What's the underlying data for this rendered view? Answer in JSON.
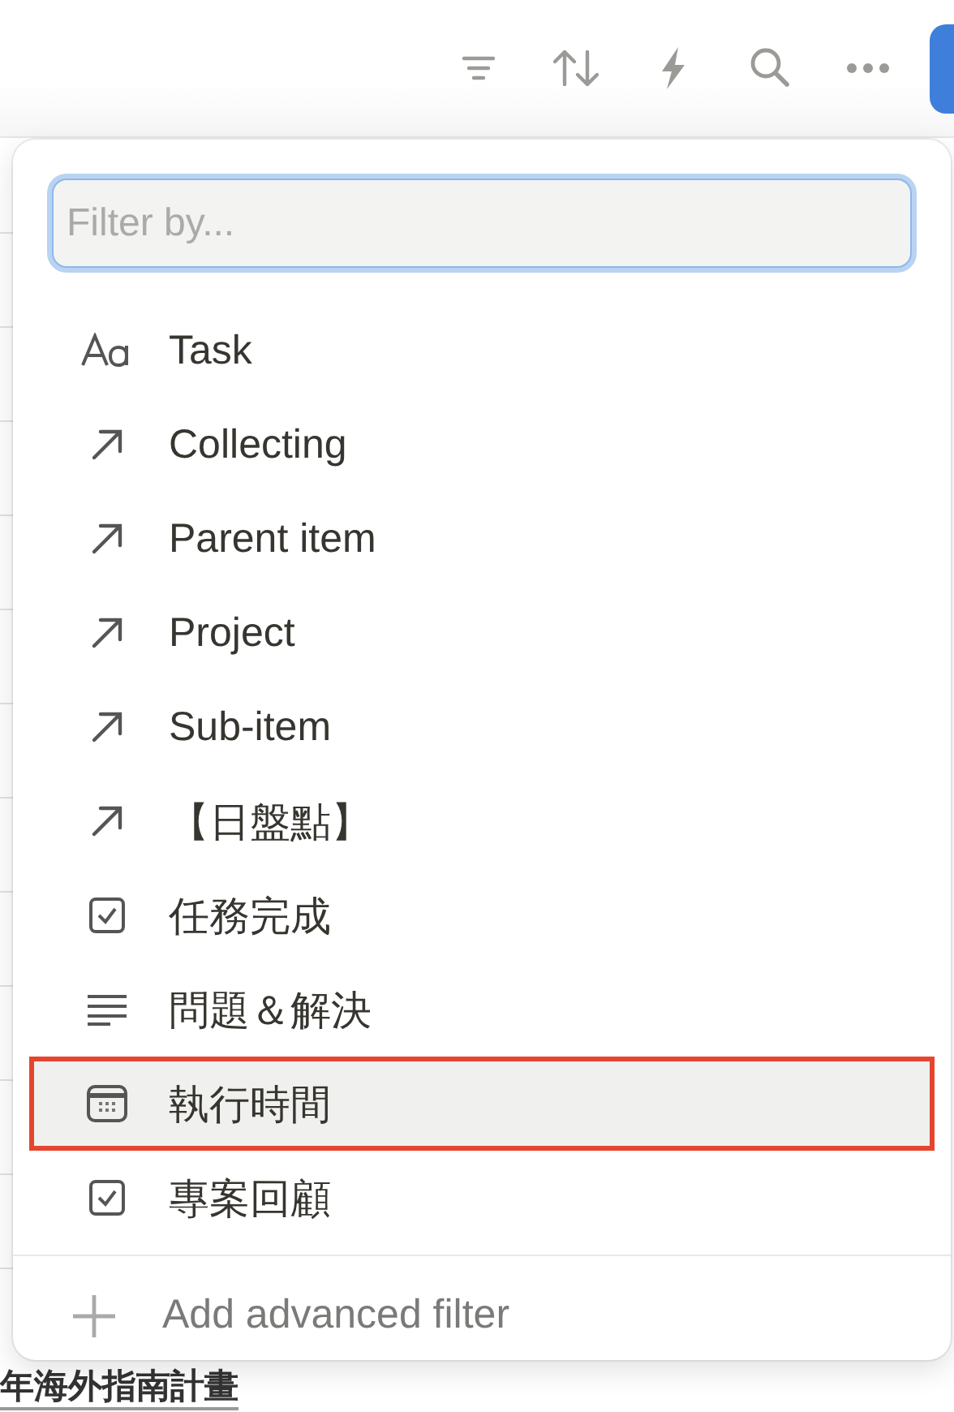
{
  "filter_menu": {
    "search": {
      "placeholder": "Filter by..."
    },
    "properties": [
      {
        "kind": "title",
        "label": "Task",
        "selected": false
      },
      {
        "kind": "relation",
        "label": "Collecting",
        "selected": false
      },
      {
        "kind": "relation",
        "label": "Parent item",
        "selected": false
      },
      {
        "kind": "relation",
        "label": "Project",
        "selected": false
      },
      {
        "kind": "relation",
        "label": "Sub-item",
        "selected": false
      },
      {
        "kind": "relation",
        "label": "【日盤點】",
        "selected": false
      },
      {
        "kind": "checkbox",
        "label": "任務完成",
        "selected": false
      },
      {
        "kind": "text",
        "label": "問題＆解決",
        "selected": false
      },
      {
        "kind": "date",
        "label": "執行時間",
        "selected": true
      },
      {
        "kind": "checkbox",
        "label": "專案回顧",
        "selected": false
      }
    ],
    "advanced": {
      "label": "Add advanced filter"
    }
  },
  "background_row": {
    "text": "年海外指南計畫"
  }
}
